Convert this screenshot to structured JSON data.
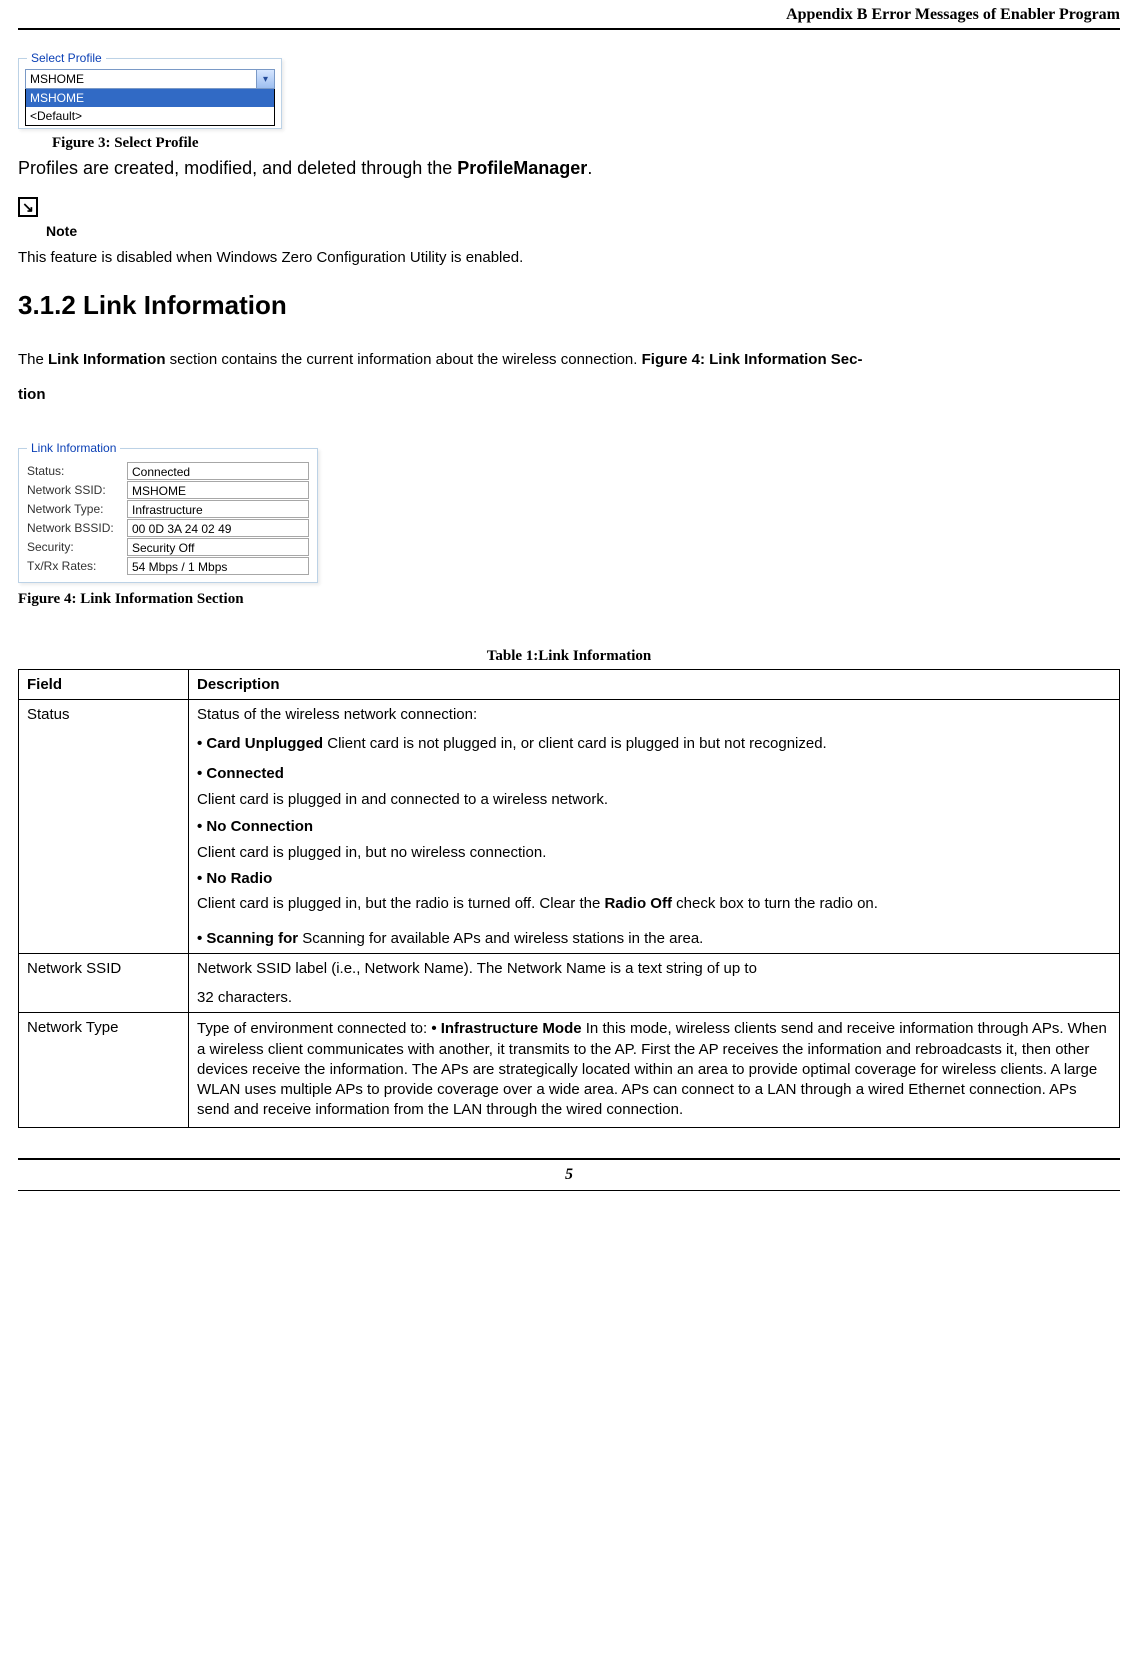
{
  "header": {
    "title": "Appendix B Error Messages of Enabler Program"
  },
  "figure3": {
    "legend": "Select Profile",
    "selected": "MSHOME",
    "options": [
      "MSHOME",
      "<Default>"
    ],
    "caption": "Figure 3: Select Profile"
  },
  "profiles_sentence": {
    "prefix": "Profiles are created, modified, and deleted through the ",
    "bold": "ProfileManager",
    "suffix": "."
  },
  "note": {
    "label": "Note",
    "text": "This feature is disabled when Windows Zero Configuration Utility is enabled."
  },
  "section_heading": "3.1.2 Link Information",
  "lead": {
    "part1_prefix": "The ",
    "part1_bold": "Link Information",
    "part1_suffix": " section contains the current information about the wireless connection. ",
    "part2_bold": "Figure 4: Link Information Section",
    "tion_word": "tion"
  },
  "figure4": {
    "legend": "Link Information",
    "rows": [
      {
        "label": "Status:",
        "value": "Connected"
      },
      {
        "label": "Network SSID:",
        "value": "MSHOME"
      },
      {
        "label": "Network Type:",
        "value": "Infrastructure"
      },
      {
        "label": "Network BSSID:",
        "value": "00 0D 3A 24 02 49"
      },
      {
        "label": "Security:",
        "value": "Security Off"
      },
      {
        "label": "Tx/Rx Rates:",
        "value": "54 Mbps / 1 Mbps"
      }
    ],
    "caption": "Figure 4: Link Information Section"
  },
  "table": {
    "title": "Table 1:Link Information",
    "head": {
      "field": "Field",
      "desc": "Description"
    },
    "rows": {
      "status": {
        "field": "Status",
        "intro": "Status of the wireless network connection:",
        "b1_bold": "• Card Unplugged",
        "b1_text": " Client card is not plugged in, or client card is plugged in but not recognized.",
        "b2_bold": "• Connected",
        "b2_text": "Client card is plugged in and connected to a wireless network.",
        "b3_bold": "• No Connection",
        "b3_text": "Client card is plugged in, but no wireless connection.",
        "b4_bold": "• No Radio",
        "b4_text_pre": "Client card is plugged in, but the radio is turned off. Clear the ",
        "b4_text_mid": "Radio Off",
        "b4_text_post": " check box to turn the radio on.",
        "b5_bold": "• Scanning for",
        "b5_text": " Scanning for available APs and wireless stations in the area."
      },
      "ssid": {
        "field": "Network SSID",
        "line1": "Network SSID label (i.e., Network Name). The Network Name is a text string of up to",
        "line2": "32 characters."
      },
      "ntype": {
        "field": "Network Type",
        "pre": "Type of environment connected to: ",
        "bold": "• Infrastructure Mode",
        "post": " In this mode, wireless clients send and receive information through APs. When a wireless client communicates with another, it transmits to the AP. First the AP receives the information and rebroadcasts it, then other devices receive the information. The APs are strategically located within an area to provide optimal coverage for wireless clients. A large WLAN uses multiple APs to provide coverage over a wide area. APs can connect to a LAN through a wired Ethernet connection. APs send and receive information from the LAN through the wired connection."
      }
    }
  },
  "footer": {
    "page": "5"
  }
}
